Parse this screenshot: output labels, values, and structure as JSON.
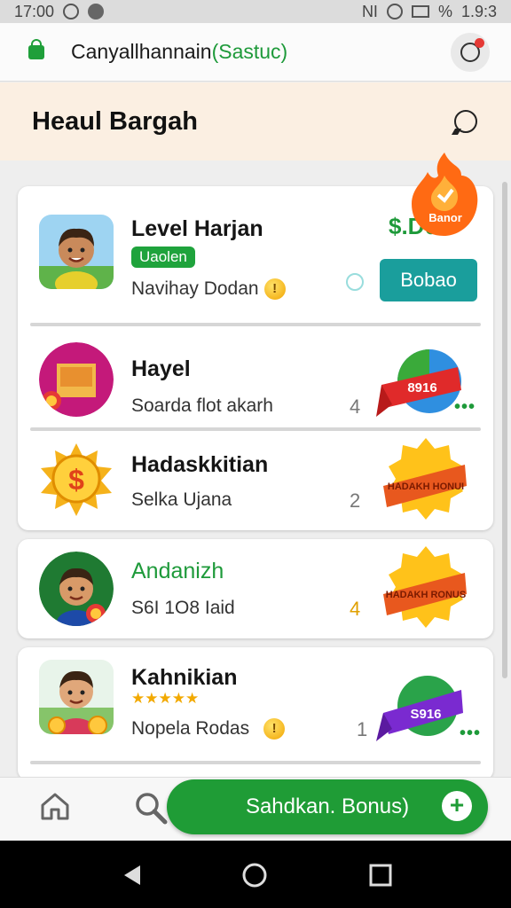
{
  "status": {
    "time": "17:00",
    "network": "NI",
    "percent": "%",
    "battery": "1.9:3"
  },
  "browser": {
    "url_main": "Canyallhannain",
    "url_suffix": "(Sastuc)"
  },
  "header": {
    "title": "Heaul Bargah"
  },
  "fire_badge": {
    "label": "Banor"
  },
  "items": [
    {
      "title": "Level Harjan",
      "tag": "Uaolen",
      "subtitle": "Navihay Dodan",
      "coin": "!",
      "price": "$.D0",
      "button": "Bobao"
    },
    {
      "title": "Hayel",
      "subtitle": "Soarda flot akarh",
      "count": "4",
      "badge": "8916",
      "bag_label": "bag"
    },
    {
      "title": "Hadaskkitian",
      "subtitle": "Selka Ujana",
      "count": "2",
      "badge": "HADAKH HONUI"
    },
    {
      "title": "Andanizh",
      "subtitle": "S6I 1O8 Iaid",
      "count": "4",
      "badge": "HADAKH RONUS"
    },
    {
      "title": "Kahnikian",
      "stars": "★★★★★",
      "subtitle": "Nopela Rodas",
      "coin": "!",
      "count": "1",
      "badge": "S916"
    }
  ],
  "bottom": {
    "cta": "Sahdkan. Bonus)",
    "plus": "+"
  },
  "colors": {
    "green": "#1f9c36",
    "teal": "#1a9e9c",
    "orange": "#ff6a13",
    "header_bg": "#fbefe2"
  }
}
